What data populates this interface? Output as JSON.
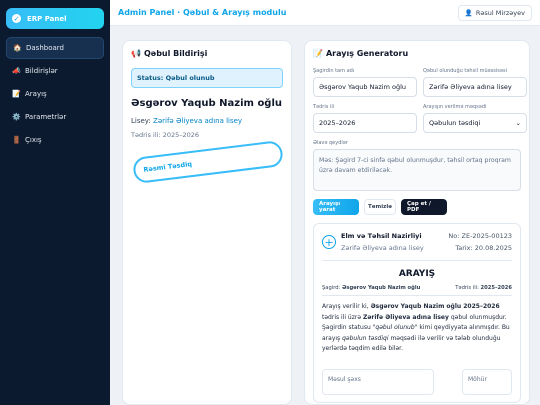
{
  "sidebar": {
    "brand": "ERP Panel",
    "items": [
      {
        "icon": "🏠",
        "label": "Dashboard",
        "active": true
      },
      {
        "icon": "📣",
        "label": "Bildirişlər"
      },
      {
        "icon": "📝",
        "label": "Arayış"
      },
      {
        "icon": "⚙️",
        "label": "Parametrlər"
      },
      {
        "icon": "🚪",
        "label": "Çıxış"
      }
    ]
  },
  "topbar": {
    "title": "Admin Panel · Qəbul & Arayış modulu",
    "user": "Rəsul Mirzəyev"
  },
  "left": {
    "header_icon": "📢",
    "header": "Qəbul Bildirişi",
    "status": "Status: Qəbul olunub",
    "student": "Əsgərov Yaqub Nazim oğlu",
    "school_label": "Lisey:",
    "school": "Zərifə Əliyeva adına lisey",
    "year": "Tədris ili: 2025–2026",
    "stamp": "Rəsmi Təsdiq"
  },
  "right": {
    "header_icon": "📝",
    "header": "Arayış Generatoru",
    "fields": {
      "name_label": "Şagirdin tam adı",
      "name_value": "Əsgərov Yaqub Nazim oğlu",
      "school_label": "Qəbul olunduğu təhsil müəssisəsi",
      "school_value": "Zərifə Əliyeva adına lisey",
      "year_label": "Tədris ili",
      "year_value": "2025–2026",
      "purpose_label": "Arayışın verilmə məqsədi",
      "purpose_value": "Qəbulun təsdiqi",
      "notes_label": "Əlavə qeydlər",
      "notes_value": "Məs: Şagird 7-ci sinfə qəbul olunmuşdur, təhsil ortaq proqram üzrə davam etdiriləcək."
    },
    "buttons": {
      "generate": "Arayışı yarat",
      "clear": "Təmizlə",
      "print": "Çap et / PDF"
    },
    "doc": {
      "org": "Elm və Təhsil Nazirliyi",
      "org_sub": "Zərifə Əliyeva adına lisey",
      "number": "No: ZE-2025-00123",
      "date": "Tarix: 20.08.2025",
      "title": "ARAYIŞ",
      "student_label": "Şagird:",
      "student": "Əsgərov Yaqub Nazim oğlu",
      "year_label": "Tədris ili:",
      "year": "2025–2026",
      "body_1": "Arayış verilir ki,",
      "body_2": "Əsgərov Yaqub Nazim oğlu 2025–2026",
      "body_3": "tədris ili üzrə",
      "body_4": "Zərifə Əliyeva adına lisey",
      "body_5": "qəbul olunmuşdur. Şagirdin statusu",
      "body_6": "\"qəbul olunub\"",
      "body_7": "kimi qeydiyyata alınmışdır. Bu arayış",
      "body_8": "qəbulun təsdiqi",
      "body_9": "məqsədi ilə verilir və tələb olunduğu yerlərdə təqdim edilə bilər.",
      "sig_label": "Məsul şəxs",
      "seal_label": "Möhür"
    }
  }
}
